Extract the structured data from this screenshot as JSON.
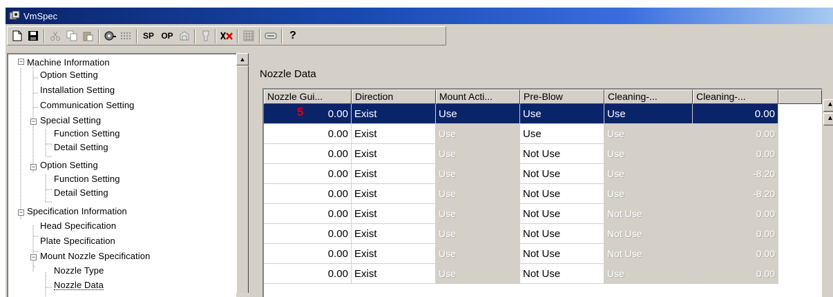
{
  "window": {
    "title": "VmSpec"
  },
  "toolbar": {
    "items": [
      {
        "id": "new",
        "icon": "new-document-icon"
      },
      {
        "id": "save",
        "icon": "save-disk-icon"
      },
      {
        "id": "cut",
        "icon": "cut-scissors-icon"
      },
      {
        "id": "copy",
        "icon": "copy-icon"
      },
      {
        "id": "paste",
        "icon": "paste-icon"
      },
      {
        "id": "reel",
        "icon": "reel-icon"
      },
      {
        "id": "dots",
        "icon": "dots-grid-icon"
      },
      {
        "id": "sp",
        "label": "SP"
      },
      {
        "id": "op",
        "label": "OP"
      },
      {
        "id": "machine",
        "icon": "machine-icon"
      },
      {
        "id": "nozzle",
        "icon": "nozzle-icon"
      },
      {
        "id": "delete",
        "icon": "delete-x-icon"
      },
      {
        "id": "grid",
        "icon": "grid-icon"
      },
      {
        "id": "card",
        "icon": "card-icon"
      },
      {
        "id": "help",
        "label": "?"
      }
    ]
  },
  "tree": {
    "nodes": [
      {
        "label": "Machine Information",
        "level": 1,
        "expander": "minus"
      },
      {
        "label": "Option Setting",
        "level": 2
      },
      {
        "label": "Installation Setting",
        "level": 2
      },
      {
        "label": "Communication Setting",
        "level": 2
      },
      {
        "label": "Special Setting",
        "level": 2,
        "expander": "minus"
      },
      {
        "label": "Function Setting",
        "level": 3
      },
      {
        "label": "Detail Setting",
        "level": 3
      },
      {
        "label": "Option Setting",
        "level": 2,
        "expander": "minus"
      },
      {
        "label": "Function Setting",
        "level": 3
      },
      {
        "label": "Detail Setting",
        "level": 3
      },
      {
        "label": "Specification Information",
        "level": 1,
        "expander": "minus"
      },
      {
        "label": "Head Specification",
        "level": 2
      },
      {
        "label": "Plate Specification",
        "level": 2
      },
      {
        "label": "Mount Nozzle Specification",
        "level": 2,
        "expander": "minus"
      },
      {
        "label": "Nozzle Type",
        "level": 3
      },
      {
        "label": "Nozzle Data",
        "level": 3,
        "selected": true
      }
    ]
  },
  "panel": {
    "title": "Nozzle Data"
  },
  "grid": {
    "marker": "5",
    "columns": [
      "Nozzle Gui...",
      "Direction",
      "Mount Acti...",
      "Pre-Blow",
      "Cleaning-...",
      "Cleaning-..."
    ],
    "rows": [
      {
        "nozzle_guide": "0.00",
        "direction": "Exist",
        "mount_action": "Use",
        "pre_blow": "Use",
        "cleaning_a": "Use",
        "cleaning_b": "0.00",
        "selected": true,
        "mount_disabled": false,
        "cleaning_a_disabled": false,
        "cleaning_b_disabled": false
      },
      {
        "nozzle_guide": "0.00",
        "direction": "Exist",
        "mount_action": "Use",
        "pre_blow": "Use",
        "cleaning_a": "Use",
        "cleaning_b": "0.00",
        "mount_disabled": true,
        "cleaning_a_disabled": true,
        "cleaning_b_disabled": true
      },
      {
        "nozzle_guide": "0.00",
        "direction": "Exist",
        "mount_action": "Use",
        "pre_blow": "Not Use",
        "cleaning_a": "Use",
        "cleaning_b": "0.00",
        "mount_disabled": true,
        "cleaning_a_disabled": true,
        "cleaning_b_disabled": true
      },
      {
        "nozzle_guide": "0.00",
        "direction": "Exist",
        "mount_action": "Use",
        "pre_blow": "Not Use",
        "cleaning_a": "Use",
        "cleaning_b": "-8.20",
        "mount_disabled": true,
        "cleaning_a_disabled": true,
        "cleaning_b_disabled": true
      },
      {
        "nozzle_guide": "0.00",
        "direction": "Exist",
        "mount_action": "Use",
        "pre_blow": "Not Use",
        "cleaning_a": "Use",
        "cleaning_b": "-8.20",
        "mount_disabled": true,
        "cleaning_a_disabled": true,
        "cleaning_b_disabled": true
      },
      {
        "nozzle_guide": "0.00",
        "direction": "Exist",
        "mount_action": "Use",
        "pre_blow": "Not Use",
        "cleaning_a": "Not Use",
        "cleaning_b": "0.00",
        "mount_disabled": true,
        "cleaning_a_disabled": true,
        "cleaning_b_disabled": true
      },
      {
        "nozzle_guide": "0.00",
        "direction": "Exist",
        "mount_action": "Use",
        "pre_blow": "Not Use",
        "cleaning_a": "Not Use",
        "cleaning_b": "0.00",
        "mount_disabled": true,
        "cleaning_a_disabled": true,
        "cleaning_b_disabled": true
      },
      {
        "nozzle_guide": "0.00",
        "direction": "Exist",
        "mount_action": "Use",
        "pre_blow": "Not Use",
        "cleaning_a": "Not Use",
        "cleaning_b": "0.00",
        "mount_disabled": true,
        "cleaning_a_disabled": true,
        "cleaning_b_disabled": true
      },
      {
        "nozzle_guide": "0.00",
        "direction": "Exist",
        "mount_action": "Use",
        "pre_blow": "Not Use",
        "cleaning_a": "Use",
        "cleaning_b": "0.00",
        "mount_disabled": true,
        "cleaning_a_disabled": true,
        "cleaning_b_disabled": true
      }
    ]
  },
  "colors": {
    "selection": "#0a246a",
    "marker": "#e00000",
    "face": "#d4d0c8"
  }
}
